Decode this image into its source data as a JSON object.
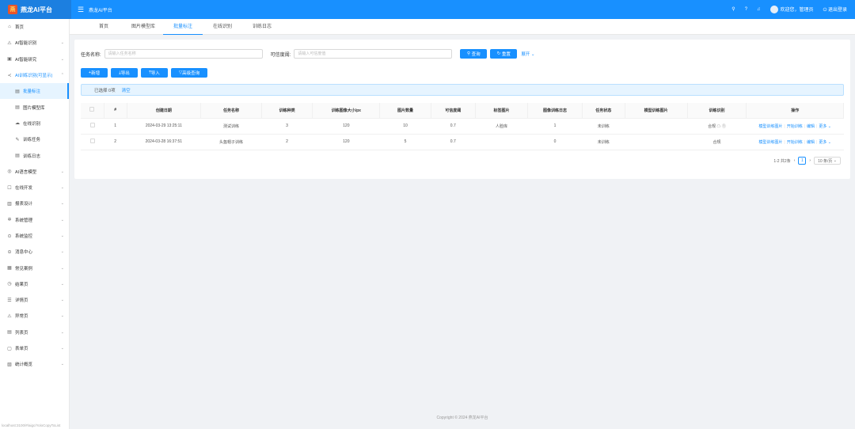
{
  "app": {
    "name": "燕龙AI平台",
    "top_title": "燕龙AI平台"
  },
  "top_right": {
    "welcome": "欢迎您，管理员",
    "logout": "退出登录"
  },
  "sidebar": {
    "items": [
      {
        "icon": "⌂",
        "label": "首页",
        "arrow": ""
      },
      {
        "icon": "⚠",
        "label": "AI智能识别",
        "arrow": "⌄"
      },
      {
        "icon": "▣",
        "label": "AI智能研究",
        "arrow": "⌄"
      },
      {
        "icon": "≺",
        "label": "AI训练识别(可显示)",
        "arrow": "⌃"
      }
    ],
    "sub_items": [
      {
        "label": "批量标注",
        "active": true
      },
      {
        "label": "图片模型库",
        "active": false
      },
      {
        "label": "在线识别",
        "active": false
      },
      {
        "label": "训练任务",
        "active": false
      },
      {
        "label": "训练日志",
        "active": false
      }
    ],
    "bottom_items": [
      {
        "icon": "◎",
        "label": "AI语言模型"
      },
      {
        "icon": "☐",
        "label": "在线开发"
      },
      {
        "icon": "▥",
        "label": "报表设计"
      },
      {
        "icon": "✲",
        "label": "系统管理"
      },
      {
        "icon": "⊙",
        "label": "系统监控"
      },
      {
        "icon": "⊝",
        "label": "消息中心"
      },
      {
        "icon": "▦",
        "label": "常见案例"
      },
      {
        "icon": "◷",
        "label": "结果页"
      },
      {
        "icon": "☰",
        "label": "详情页"
      },
      {
        "icon": "⚠",
        "label": "异常页"
      },
      {
        "icon": "▤",
        "label": "列表页"
      },
      {
        "icon": "▢",
        "label": "表单页"
      },
      {
        "icon": "▧",
        "label": "统计概览"
      }
    ],
    "status_url": "localhost:3100/#/aigc/YoloCopyToList"
  },
  "tabs": [
    "首页",
    "图片模型库",
    "批量标注",
    "在线识别",
    "训练日志"
  ],
  "search": {
    "task_label": "任务名称:",
    "task_placeholder": "请输入任务名称",
    "conf_label": "可信度阈:",
    "conf_placeholder": "请输入可信度值",
    "query": "查询",
    "reset": "重置",
    "expand": "展开"
  },
  "actions": {
    "add": "新增",
    "export": "导出",
    "import": "导入",
    "advanced": "高级查询"
  },
  "alert": {
    "text": "已选择 0项",
    "clear": "清空"
  },
  "table": {
    "headers": [
      "#",
      "创建日期",
      "任务名称",
      "训练种类",
      "训练图像大小/px",
      "图片数量",
      "可信度阈",
      "标签图片",
      "图像训练日志",
      "任务状态",
      "模型训练图片",
      "训练识别",
      "操作"
    ],
    "rows": [
      [
        "1",
        "2024-03-29 13:25:11",
        "测试训练",
        "3",
        "120",
        "10",
        "0.7",
        "人脸库",
        "1",
        "未训练",
        "",
        "合规 ☁ ①"
      ],
      [
        "2",
        "2024-03-28 16:37:51",
        "头盔帽子训练",
        "2",
        "120",
        "5",
        "0.7",
        "",
        "0",
        "未训练",
        "",
        "合规"
      ]
    ],
    "ops": [
      "模型训练图片",
      "开始训练",
      "编辑",
      "更多"
    ]
  },
  "pager": {
    "summary": "1-2 共2条",
    "page": "1",
    "size": "10 条/页"
  },
  "footer": "Copyright © 2024 燕龙AI平台"
}
